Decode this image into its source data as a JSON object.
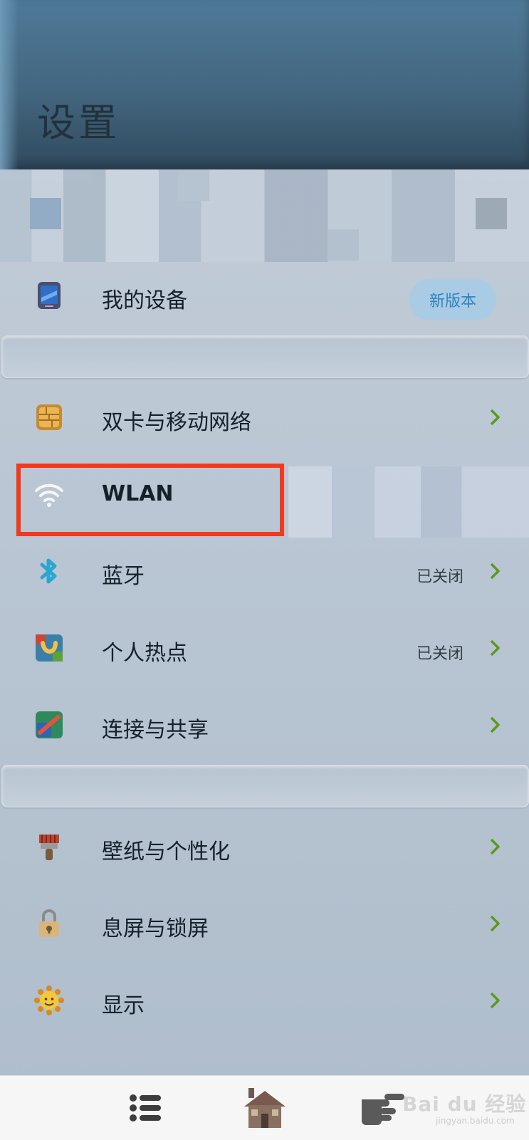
{
  "header": {
    "title": "设置"
  },
  "account": {
    "badge": "新版本"
  },
  "items": [
    {
      "label": "我的设备",
      "status": "",
      "icon": "device-icon"
    },
    {
      "label": "双卡与移动网络",
      "status": "",
      "icon": "sim-card-icon"
    },
    {
      "label": "WLAN",
      "status": "",
      "icon": "wifi-icon"
    },
    {
      "label": "蓝牙",
      "status": "已关闭",
      "icon": "bluetooth-icon"
    },
    {
      "label": "个人热点",
      "status": "已关闭",
      "icon": "hotspot-icon"
    },
    {
      "label": "连接与共享",
      "status": "",
      "icon": "share-icon"
    },
    {
      "label": "壁纸与个性化",
      "status": "",
      "icon": "brush-icon"
    },
    {
      "label": "息屏与锁屏",
      "status": "",
      "icon": "lock-icon"
    },
    {
      "label": "显示",
      "status": "",
      "icon": "sun-icon"
    }
  ],
  "tabs": [
    {
      "icon": "list-icon"
    },
    {
      "icon": "home-icon"
    },
    {
      "icon": "pointing-hand-icon"
    }
  ],
  "watermark": {
    "text": "Bai du 经验",
    "sub": "jingyan.baidu.com"
  },
  "colors": {
    "highlight": "#f2391c",
    "badge_bg": "#a9cbe3",
    "badge_text": "#2f83c3",
    "chevron": "#5a9a1e"
  }
}
